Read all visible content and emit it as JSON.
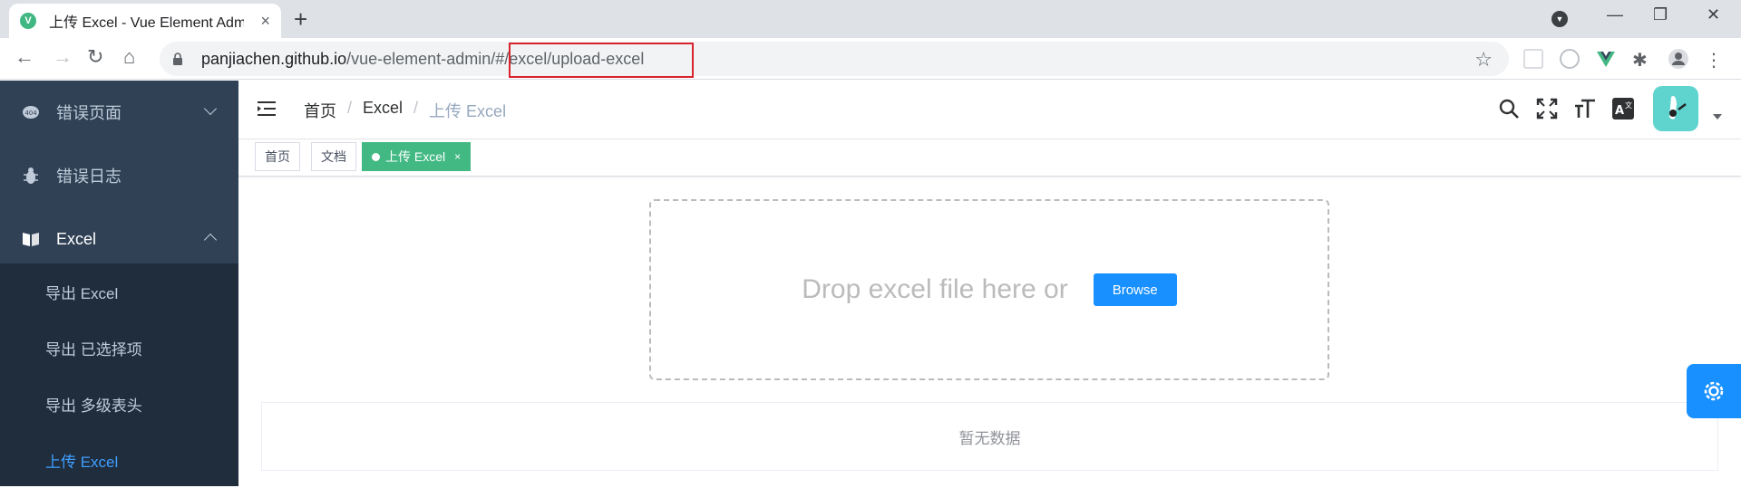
{
  "browser": {
    "tab_title": "上传 Excel - Vue Element Admin",
    "tab_close": "×",
    "new_tab": "+",
    "favicon": "V",
    "url_host": "panjiachen.github.io",
    "url_path": "/vue-element-admin/#/excel/upload-excel",
    "window_minimize": "—",
    "window_restore": "❐",
    "window_close": "✕"
  },
  "sidebar": {
    "items": [
      {
        "label": "错误页面",
        "icon": "404-icon"
      },
      {
        "label": "错误日志",
        "icon": "bug-icon"
      },
      {
        "label": "Excel",
        "icon": "excel-icon"
      }
    ],
    "submenu": [
      {
        "label": "导出 Excel"
      },
      {
        "label": "导出 已选择项"
      },
      {
        "label": "导出 多级表头"
      },
      {
        "label": "上传 Excel"
      }
    ]
  },
  "navbar": {
    "breadcrumb": [
      "首页",
      "Excel",
      "上传 Excel"
    ],
    "breadcrumb_sep": "/"
  },
  "tags": [
    {
      "label": "首页"
    },
    {
      "label": "文档"
    },
    {
      "label": "上传 Excel",
      "close": "×"
    }
  ],
  "upload": {
    "drop_text": "Drop excel file here or",
    "browse_label": "Browse"
  },
  "table": {
    "empty_text": "暂无数据"
  },
  "colors": {
    "sidebar_bg": "#304156",
    "submenu_bg": "#1f2d3d",
    "active_menu": "#409eff",
    "tag_active": "#42b983",
    "primary": "#1890ff"
  }
}
